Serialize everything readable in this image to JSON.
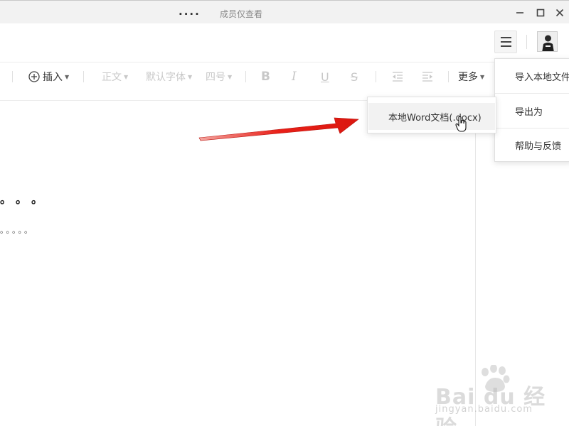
{
  "titlebar": {
    "doc_dots": "....",
    "subtitle": "成员仅查看",
    "minimize_glyph": "—",
    "maximize_glyph": "☐",
    "close_glyph": "✕"
  },
  "header": {
    "menu_icon": "hamburger-icon",
    "avatar": "user-avatar"
  },
  "toolbar": {
    "insert_label": "插入",
    "style_label": "正文",
    "font_label": "默认字体",
    "size_label": "四号",
    "bold_glyph": "B",
    "italic_glyph": "I",
    "underline_glyph": "U",
    "strike_glyph": "S",
    "more_label": "更多"
  },
  "document": {
    "heading": "。。。",
    "body": "。。。。。"
  },
  "main_menu": {
    "items": [
      {
        "label": "导入本地文件"
      },
      {
        "label": "导出为"
      },
      {
        "label": "帮助与反馈"
      }
    ]
  },
  "sub_menu": {
    "items": [
      {
        "label": "本地Word文档(.docx)"
      }
    ]
  },
  "watermark": {
    "brand": "Bai du 经验",
    "url": "jingyan.baidu.com"
  },
  "colors": {
    "arrow": "#e8140c",
    "disabled": "#c8c8c8",
    "highlight": "#f2f2f2"
  }
}
